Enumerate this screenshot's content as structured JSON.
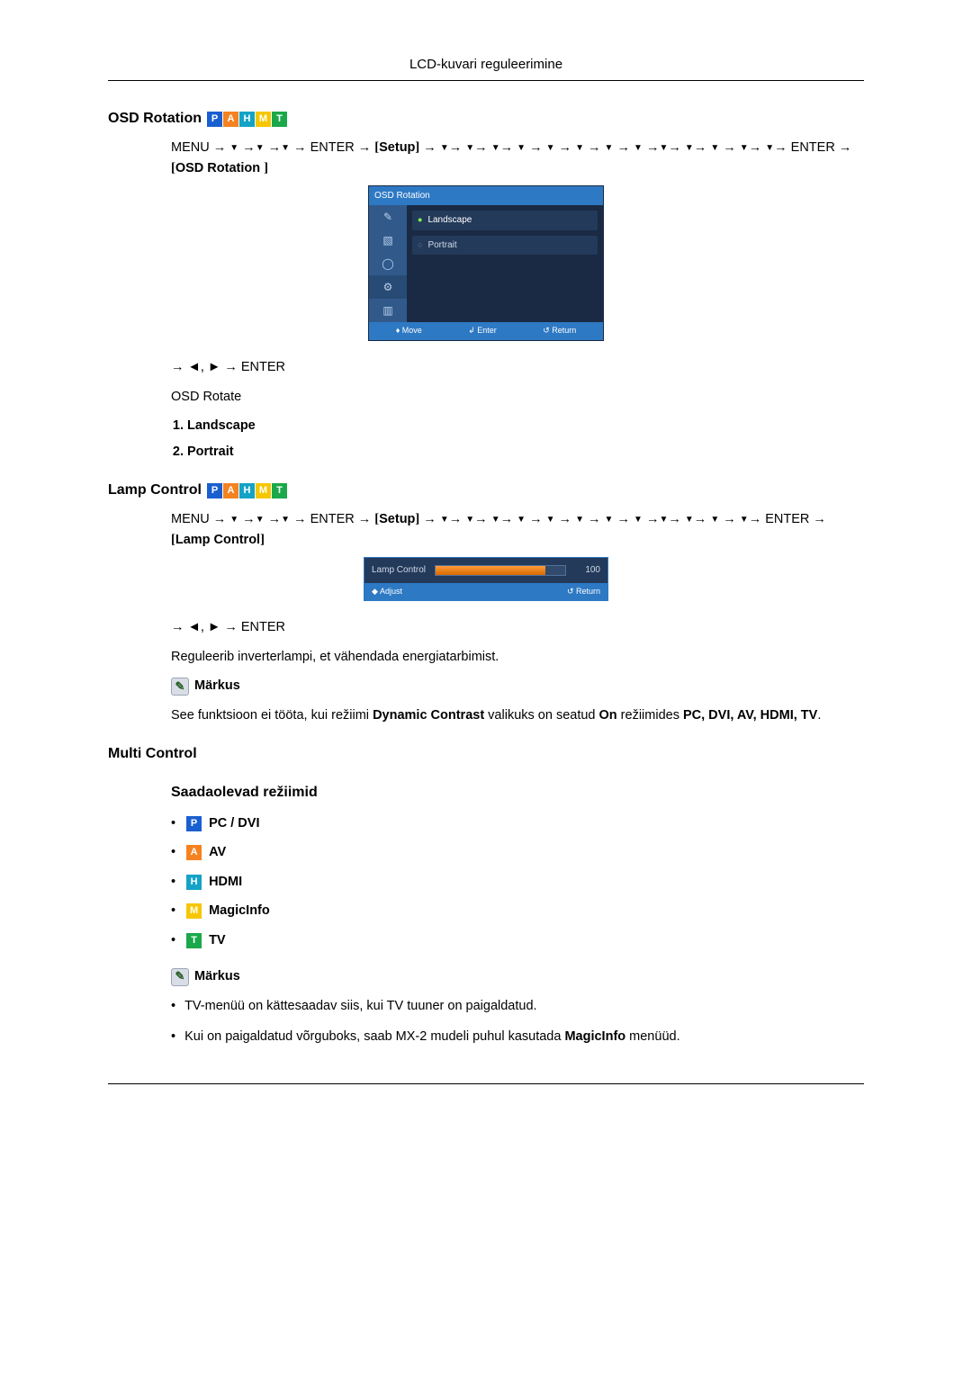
{
  "header": {
    "title": "LCD-kuvari reguleerimine"
  },
  "badges": {
    "P": "P",
    "A": "A",
    "H": "H",
    "M": "M",
    "T": "T"
  },
  "osd": {
    "title": "OSD Rotation",
    "nav_menu": "MENU → ",
    "nav_enter": " → ENTER → ",
    "setup_label": "Setup",
    "nav_tail1": " → ",
    "nav_last_label": "OSD Rotation",
    "shot_header": "OSD Rotation",
    "opt_landscape": "Landscape",
    "opt_portrait": "Portrait",
    "footer_move": "Move",
    "footer_enter": "Enter",
    "footer_return": "Return",
    "post_nav": "→ ◄, ► → ENTER",
    "rotate_label": "OSD Rotate",
    "list_1": "Landscape",
    "list_2": "Portrait"
  },
  "lamp": {
    "title": "Lamp Control",
    "nav_enter2": " ENTER → ",
    "last_label": "Lamp Control",
    "shot_label": "Lamp Control",
    "shot_value": "100",
    "footer_adjust": "Adjust",
    "footer_return": "Return",
    "post_nav": "→ ◄, ► → ENTER",
    "desc": "Reguleerib inverterlampi, et vähendada energiatarbimist.",
    "note_label": "Märkus",
    "note_text_pre": "See funktsioon ei tööta, kui režiimi ",
    "note_dynamic": "Dynamic Contrast",
    "note_mid": " valikuks on seatud ",
    "note_on": "On",
    "note_modes_label": " režiimides ",
    "note_modes": "PC, DVI, AV, HDMI, TV",
    "note_end": "."
  },
  "multi": {
    "title": "Multi Control",
    "subtitle": "Saadaolevad režiimid",
    "modes": {
      "pc": "PC / DVI",
      "av": "AV",
      "hdmi": "HDMI",
      "magic": "MagicInfo",
      "tv": "TV"
    },
    "note_label": "Märkus",
    "bullet1": "TV-menüü on kättesaadav siis, kui TV tuuner on paigaldatud.",
    "bullet2_pre": "Kui on paigaldatud võrguboks, saab MX-2 mudeli puhul kasutada ",
    "bullet2_bold": "MagicInfo",
    "bullet2_post": " menüüd."
  }
}
